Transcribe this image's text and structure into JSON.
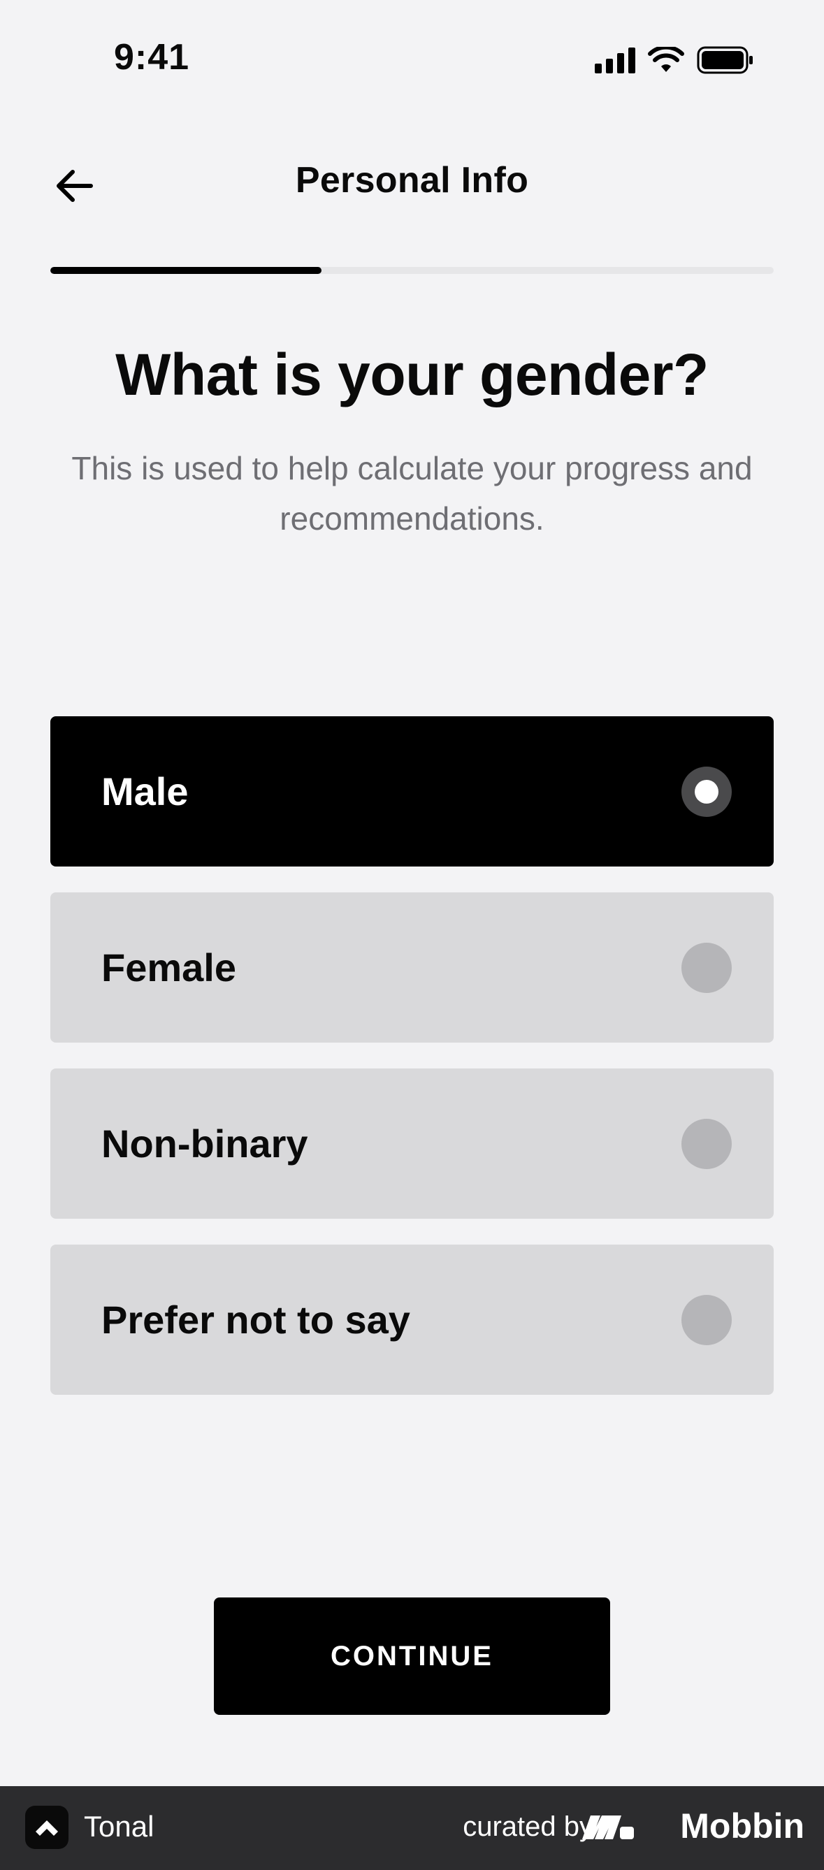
{
  "status_bar": {
    "time": "9:41"
  },
  "header": {
    "title": "Personal Info"
  },
  "progress": {
    "fraction": 0.375
  },
  "question": {
    "title": "What is your gender?",
    "subtitle": "This is used to help calculate your progress and recommendations."
  },
  "options": [
    {
      "label": "Male",
      "selected": true
    },
    {
      "label": "Female",
      "selected": false
    },
    {
      "label": "Non-binary",
      "selected": false
    },
    {
      "label": "Prefer not to say",
      "selected": false
    }
  ],
  "continue_button": {
    "label": "CONTINUE"
  },
  "footer": {
    "app_name": "Tonal",
    "curated_by": "curated by",
    "brand": "Mobbin"
  },
  "colors": {
    "background": "#f3f3f5",
    "selected": "#000000",
    "option": "#d9d9db",
    "radio": "#b5b5b8"
  }
}
